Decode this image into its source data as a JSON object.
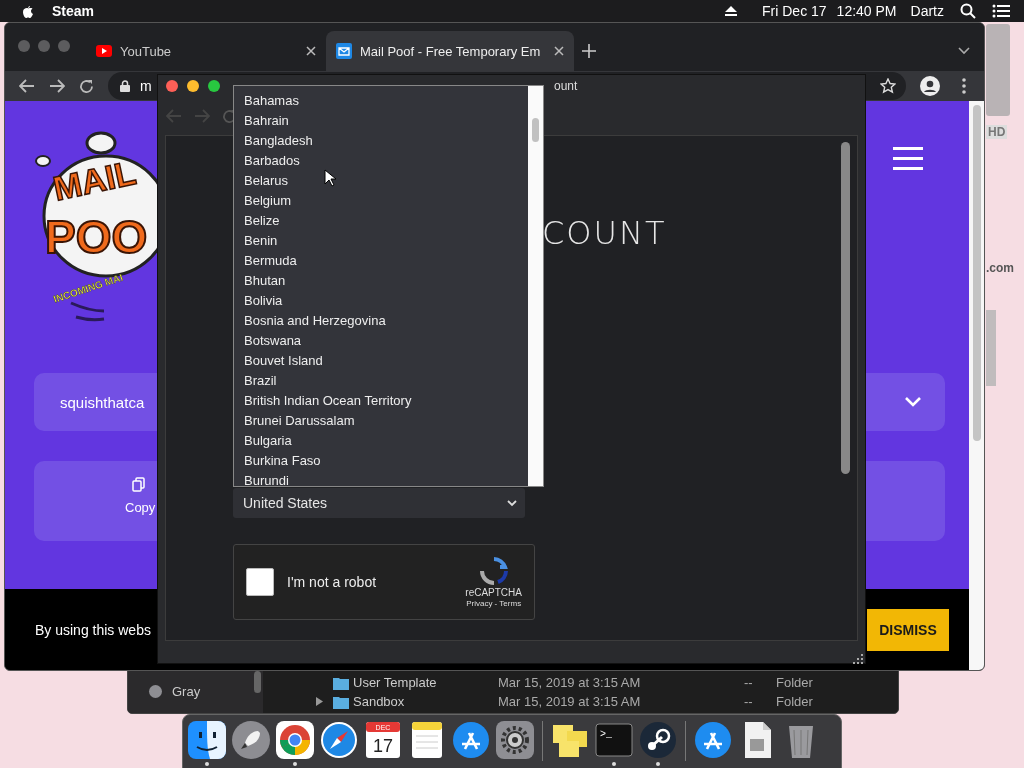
{
  "menu_bar": {
    "app": "Steam",
    "date": "Fri Dec 17",
    "time": "12:40 PM",
    "user": "Dartz"
  },
  "desktop_labels": [
    "HD",
    ".com"
  ],
  "browser": {
    "tabs": [
      {
        "title": "YouTube",
        "selected": false
      },
      {
        "title": "Mail Poof - Free Temporary Em",
        "selected": true
      }
    ],
    "address": "m",
    "page": {
      "logo": {
        "top": "MAIL",
        "middle": "POO",
        "ribbon": "INCOMING MAI"
      },
      "email": "squishthatca",
      "copy_label": "Copy",
      "cookie_text": "By using this webs",
      "dismiss": "DISMISS"
    }
  },
  "popup": {
    "title": "ount",
    "heading": "COUNT",
    "country_list": [
      {
        "name": "Bahamas",
        "selected": false
      },
      {
        "name": "Bahrain",
        "selected": false
      },
      {
        "name": "Bangladesh",
        "selected": false
      },
      {
        "name": "Barbados",
        "selected": false
      },
      {
        "name": "Belarus",
        "selected": false
      },
      {
        "name": "Belgium",
        "selected": false
      },
      {
        "name": "Belize",
        "selected": false
      },
      {
        "name": "Benin",
        "selected": false
      },
      {
        "name": "Bermuda",
        "selected": false
      },
      {
        "name": "Bhutan",
        "selected": false
      },
      {
        "name": "Bolivia",
        "selected": false
      },
      {
        "name": "Bosnia and Herzegovina",
        "selected": false
      },
      {
        "name": "Botswana",
        "selected": false
      },
      {
        "name": "Bouvet Island",
        "selected": false
      },
      {
        "name": "Brazil",
        "selected": false
      },
      {
        "name": "British Indian Ocean Territory",
        "selected": false
      },
      {
        "name": "Brunei Darussalam",
        "selected": false
      },
      {
        "name": "Bulgaria",
        "selected": false
      },
      {
        "name": "Burkina Faso",
        "selected": false
      },
      {
        "name": "Burundi",
        "selected": false
      }
    ],
    "country_select": "United States",
    "captcha": {
      "label": "I'm not a robot",
      "checked": false,
      "brand": "reCAPTCHA",
      "links": "Privacy - Terms"
    }
  },
  "finder": {
    "sidebar_item": {
      "label": "Gray",
      "color": "#8e8e93"
    },
    "rows": [
      {
        "name": "User Template",
        "date": "Mar 15, 2019 at 3:15 AM",
        "size": "--",
        "kind": "Folder"
      },
      {
        "name": "Sandbox",
        "expanded": false,
        "date": "Mar 15, 2019 at 3:15 AM",
        "size": "--",
        "kind": "Folder"
      }
    ]
  },
  "dock": {
    "apps": [
      {
        "kind": "finder",
        "running": true
      },
      {
        "kind": "launchpad",
        "running": false
      },
      {
        "kind": "chrome",
        "running": true
      },
      {
        "kind": "safari",
        "running": false
      },
      {
        "kind": "calendar",
        "month": "DEC",
        "day": "17",
        "running": false
      },
      {
        "kind": "notes",
        "running": false
      },
      {
        "kind": "appstore",
        "running": false
      },
      {
        "kind": "settings",
        "running": false
      },
      {
        "kind": "separator"
      },
      {
        "kind": "stickies",
        "running": false
      },
      {
        "kind": "terminal",
        "prompt": ">_",
        "running": true
      },
      {
        "kind": "steam",
        "running": true
      },
      {
        "kind": "separator"
      },
      {
        "kind": "appstore",
        "running": false
      },
      {
        "kind": "file",
        "running": false
      },
      {
        "kind": "trash",
        "running": false
      }
    ]
  }
}
